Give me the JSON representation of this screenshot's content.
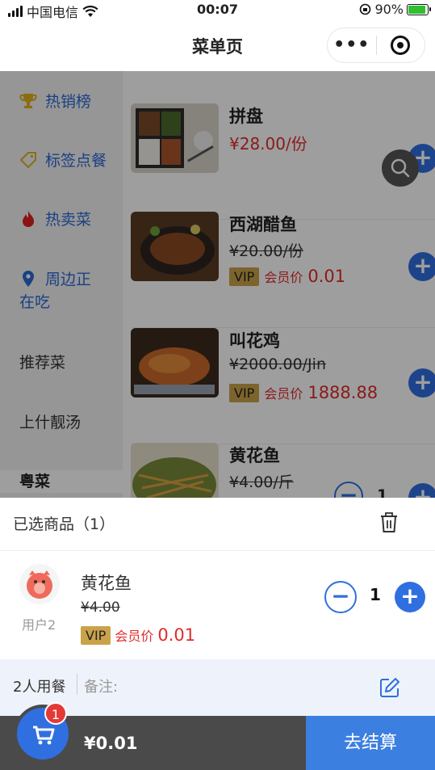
{
  "status_bar": {
    "carrier": "中国电信",
    "time": "00:07",
    "battery": "90%"
  },
  "nav": {
    "title": "菜单页",
    "more_label": "•••"
  },
  "sidebar": {
    "items": [
      {
        "label": "热销榜",
        "icon": "trophy-icon"
      },
      {
        "label": "标签点餐",
        "icon": "tag-icon"
      },
      {
        "label": "热卖菜",
        "icon": "flame-icon"
      },
      {
        "label": "周边正",
        "label2": "在吃",
        "icon": "location-pin-icon"
      },
      {
        "label": "推荐菜"
      },
      {
        "label": "上什靓汤"
      },
      {
        "label": "粤菜"
      }
    ]
  },
  "dishes": [
    {
      "name": "拼盘",
      "price": "¥28.00/份"
    },
    {
      "name": "西湖醋鱼",
      "old_price": "¥20.00/份",
      "vip_tag": "VIP",
      "vip_label": "会员价",
      "vip_price": "0.01"
    },
    {
      "name": "叫花鸡",
      "old_price": "¥2000.00/Jin",
      "vip_tag": "VIP",
      "vip_label": "会员价",
      "vip_price": "1888.88"
    },
    {
      "name": "黄花鱼",
      "old_price": "¥4.00/斤",
      "qty": "1"
    }
  ],
  "cart": {
    "title": "已选商品（1）",
    "item": {
      "user": "用户2",
      "name": "黄花鱼",
      "old_price": "¥4.00",
      "vip_tag": "VIP",
      "vip_label": "会员价",
      "vip_price": "0.01",
      "qty": "1"
    }
  },
  "notes": {
    "diners": "2人用餐",
    "label": "备注:"
  },
  "checkout": {
    "total": "¥0.01",
    "button": "去结算",
    "badge": "1"
  },
  "colors": {
    "accent": "#2f6fe0",
    "price": "#e02c2c",
    "vip_tag": "#c9a24a"
  }
}
